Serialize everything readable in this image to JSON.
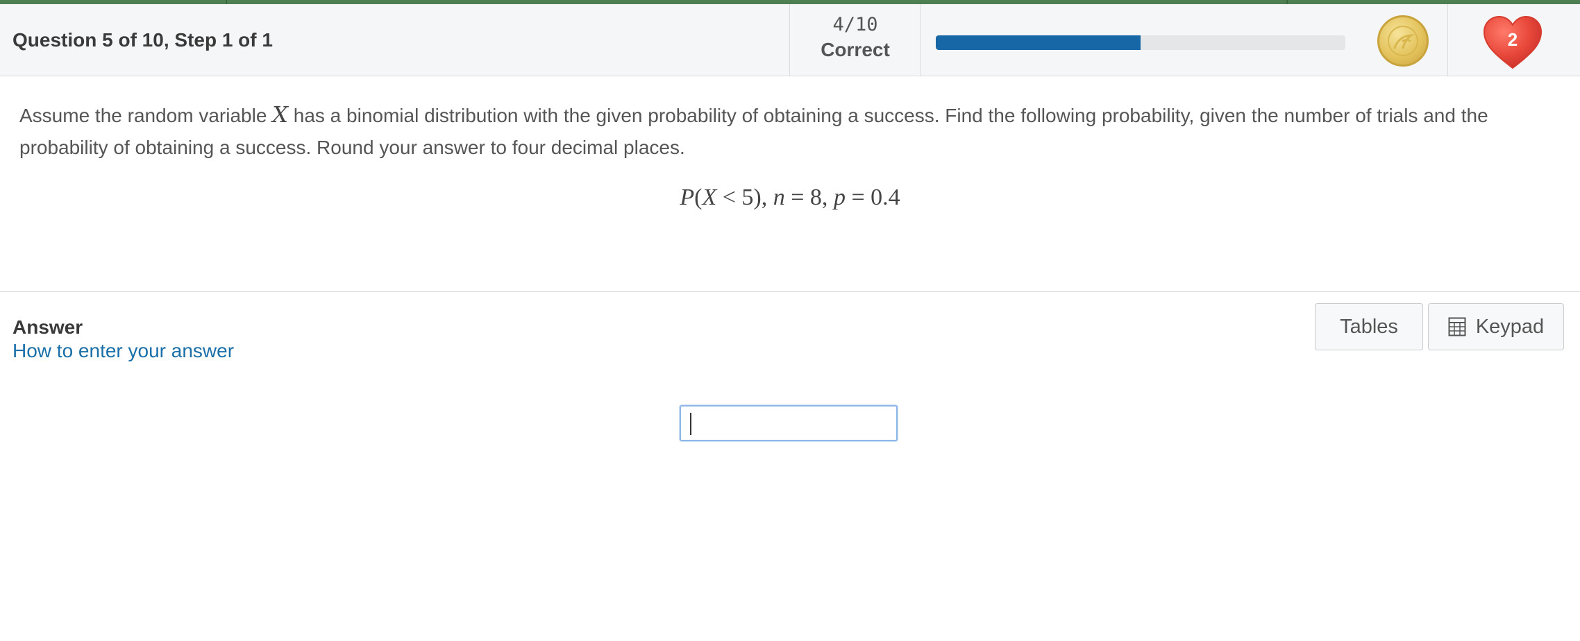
{
  "header": {
    "question_title": "Question 5 of 10, Step 1 of 1",
    "score_fraction": "4/10",
    "score_label": "Correct",
    "progress_fraction": 0.5,
    "coin_icon": "coin-icon",
    "hearts_count": "2",
    "heart_icon": "heart-icon",
    "colors": {
      "accent_bar": "#4d7f53",
      "progress": "#1766a5",
      "heart": "#e8483a",
      "link": "#1a6fa8"
    }
  },
  "question": {
    "text_before_var": "Assume the random variable ",
    "variable": "X",
    "text_after_var": " has a binomial distribution with the given probability of obtaining a success. Find the following probability, given the number of trials and the probability of obtaining a success. Round your answer to four decimal places.",
    "formula": {
      "P": "P",
      "open": "(",
      "X": "X",
      "lt": " < 5),",
      "n": "n",
      "n_eq": " = 8,",
      "p": "p",
      "p_eq": " = 0.4"
    }
  },
  "answer": {
    "label": "Answer",
    "help_link": "How to enter your answer",
    "input_value": "",
    "tables_button": "Tables",
    "keypad_button": "Keypad",
    "keypad_icon": "calculator-icon"
  }
}
